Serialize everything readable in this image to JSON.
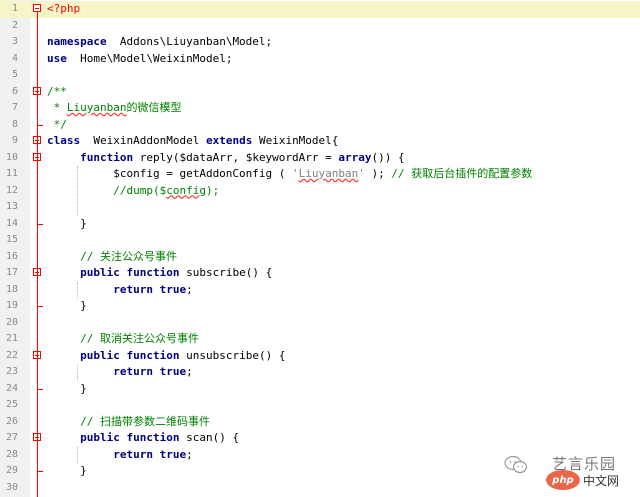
{
  "lines": [
    {
      "n": "1",
      "c": [
        [
          "php",
          "<?php"
        ]
      ]
    },
    {
      "n": "2",
      "c": []
    },
    {
      "n": "3",
      "c": [
        [
          "kw",
          "namespace"
        ],
        [
          "",
          "  Addons\\Liuyanban\\Model;"
        ]
      ]
    },
    {
      "n": "4",
      "c": [
        [
          "kw",
          "use"
        ],
        [
          "",
          "  Home\\Model\\WeixinModel;"
        ]
      ]
    },
    {
      "n": "5",
      "c": []
    },
    {
      "n": "6",
      "c": [
        [
          "cmt",
          "/**"
        ]
      ]
    },
    {
      "n": "7",
      "c": [
        [
          "cmt",
          " * "
        ],
        [
          "cmt spell",
          "Liuyanban"
        ],
        [
          "cmt",
          "的微信模型"
        ]
      ]
    },
    {
      "n": "8",
      "c": [
        [
          "cmt",
          " */"
        ]
      ]
    },
    {
      "n": "9",
      "c": [
        [
          "kw",
          "class"
        ],
        [
          "",
          "  WeixinAddonModel "
        ],
        [
          "kw",
          "extends"
        ],
        [
          "",
          " WeixinModel{"
        ]
      ]
    },
    {
      "n": "10",
      "c": [
        [
          "",
          "     "
        ],
        [
          "kw",
          "function"
        ],
        [
          "",
          " reply($dataArr, $keywordArr = "
        ],
        [
          "kw",
          "array"
        ],
        [
          "",
          "()) {"
        ]
      ]
    },
    {
      "n": "11",
      "c": [
        [
          "",
          "          $config = getAddonConfig ( "
        ],
        [
          "str",
          "'"
        ],
        [
          "str spell",
          "Liuyanban"
        ],
        [
          "str",
          "'"
        ],
        [
          "",
          " ); "
        ],
        [
          "cmt",
          "// 获取后台插件的配置参数"
        ]
      ]
    },
    {
      "n": "12",
      "c": [
        [
          "",
          "          "
        ],
        [
          "cmt",
          "//dump($"
        ],
        [
          "cmt spell",
          "config"
        ],
        [
          "cmt",
          ");"
        ]
      ]
    },
    {
      "n": "13",
      "c": []
    },
    {
      "n": "14",
      "c": [
        [
          "",
          "     }"
        ]
      ]
    },
    {
      "n": "15",
      "c": []
    },
    {
      "n": "16",
      "c": [
        [
          "",
          "     "
        ],
        [
          "cmt",
          "// 关注公众号事件"
        ]
      ]
    },
    {
      "n": "17",
      "c": [
        [
          "",
          "     "
        ],
        [
          "kw",
          "public"
        ],
        [
          "",
          " "
        ],
        [
          "kw",
          "function"
        ],
        [
          "",
          " subscribe() {"
        ]
      ]
    },
    {
      "n": "18",
      "c": [
        [
          "",
          "          "
        ],
        [
          "kw",
          "return"
        ],
        [
          "",
          " "
        ],
        [
          "kw",
          "true"
        ],
        [
          "",
          ";"
        ]
      ]
    },
    {
      "n": "19",
      "c": [
        [
          "",
          "     }"
        ]
      ]
    },
    {
      "n": "20",
      "c": []
    },
    {
      "n": "21",
      "c": [
        [
          "",
          "     "
        ],
        [
          "cmt",
          "// 取消关注公众号事件"
        ]
      ]
    },
    {
      "n": "22",
      "c": [
        [
          "",
          "     "
        ],
        [
          "kw",
          "public"
        ],
        [
          "",
          " "
        ],
        [
          "kw",
          "function"
        ],
        [
          "",
          " unsubscribe() {"
        ]
      ]
    },
    {
      "n": "23",
      "c": [
        [
          "",
          "          "
        ],
        [
          "kw",
          "return"
        ],
        [
          "",
          " "
        ],
        [
          "kw",
          "true"
        ],
        [
          "",
          ";"
        ]
      ]
    },
    {
      "n": "24",
      "c": [
        [
          "",
          "     }"
        ]
      ]
    },
    {
      "n": "25",
      "c": []
    },
    {
      "n": "26",
      "c": [
        [
          "",
          "     "
        ],
        [
          "cmt",
          "// 扫描带参数二维码事件"
        ]
      ]
    },
    {
      "n": "27",
      "c": [
        [
          "",
          "     "
        ],
        [
          "kw",
          "public"
        ],
        [
          "",
          " "
        ],
        [
          "kw",
          "function"
        ],
        [
          "",
          " scan() {"
        ]
      ]
    },
    {
      "n": "28",
      "c": [
        [
          "",
          "          "
        ],
        [
          "kw",
          "return"
        ],
        [
          "",
          " "
        ],
        [
          "kw",
          "true"
        ],
        [
          "",
          ";"
        ]
      ]
    },
    {
      "n": "29",
      "c": [
        [
          "",
          "     }"
        ]
      ]
    },
    {
      "n": "30",
      "c": []
    }
  ],
  "folds": {
    "start": [
      "1",
      "6",
      "9",
      "10",
      "17",
      "22",
      "27"
    ],
    "end": [
      "8",
      "14",
      "19",
      "24",
      "29"
    ]
  },
  "watermark": {
    "brand": "艺言乐园",
    "logo": "php",
    "site": "中文网"
  }
}
